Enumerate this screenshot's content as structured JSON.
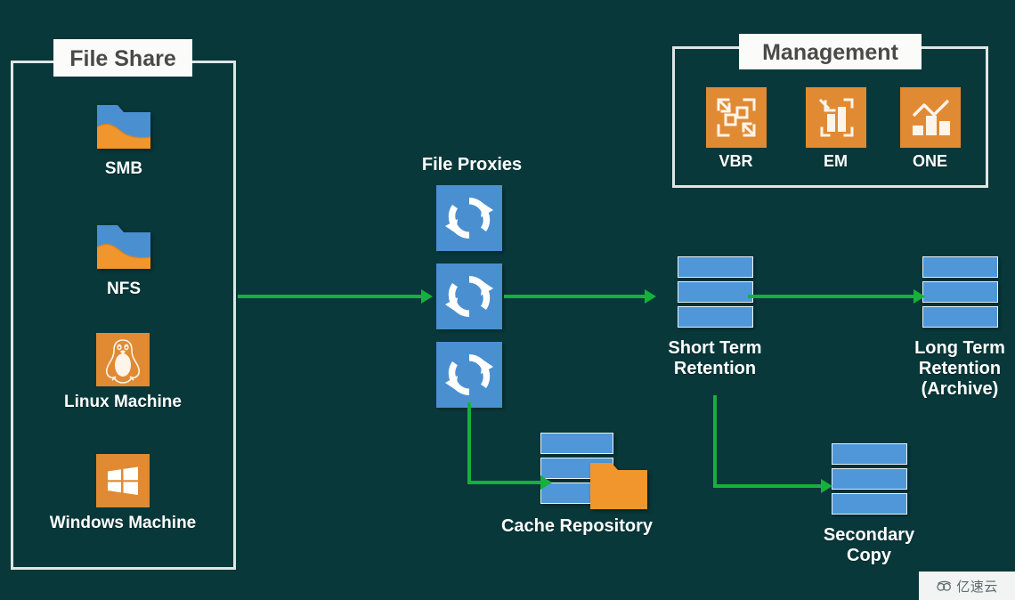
{
  "diagram": {
    "background_color": "#08383a",
    "accent_arrow_color": "#16b03c",
    "tile_blue": "#4a90d0",
    "tile_orange": "#e08b33",
    "box_border_color": "#dfe6e6"
  },
  "groups": {
    "file_share": {
      "title": "File Share"
    },
    "management": {
      "title": "Management"
    }
  },
  "file_share_nodes": [
    {
      "label": "SMB",
      "icon": "folder-share-icon"
    },
    {
      "label": "NFS",
      "icon": "folder-share-icon"
    },
    {
      "label": "Linux Machine",
      "icon": "linux-penguin-icon"
    },
    {
      "label": "Windows Machine",
      "icon": "windows-logo-icon"
    }
  ],
  "management_nodes": [
    {
      "label": "VBR",
      "icon": "backup-replication-icon"
    },
    {
      "label": "EM",
      "icon": "enterprise-manager-icon"
    },
    {
      "label": "ONE",
      "icon": "monitoring-chart-icon"
    }
  ],
  "proxies": {
    "title": "File Proxies",
    "items": [
      {
        "icon": "sync-arrows-icon"
      },
      {
        "icon": "sync-arrows-icon"
      },
      {
        "icon": "sync-arrows-icon"
      }
    ]
  },
  "repositories": [
    {
      "id": "short-term-retention",
      "label": "Short Term\nRetention",
      "icon": "storage-stack-icon"
    },
    {
      "id": "long-term-retention",
      "label": "Long Term\nRetention\n(Archive)",
      "icon": "storage-stack-icon"
    },
    {
      "id": "cache-repository",
      "label": "Cache Repository",
      "icon": "storage-stack-folder-icon"
    },
    {
      "id": "secondary-copy",
      "label": "Secondary\nCopy",
      "icon": "storage-stack-icon"
    }
  ],
  "watermark": {
    "text": "亿速云",
    "icon": "cloud-logo-icon"
  }
}
